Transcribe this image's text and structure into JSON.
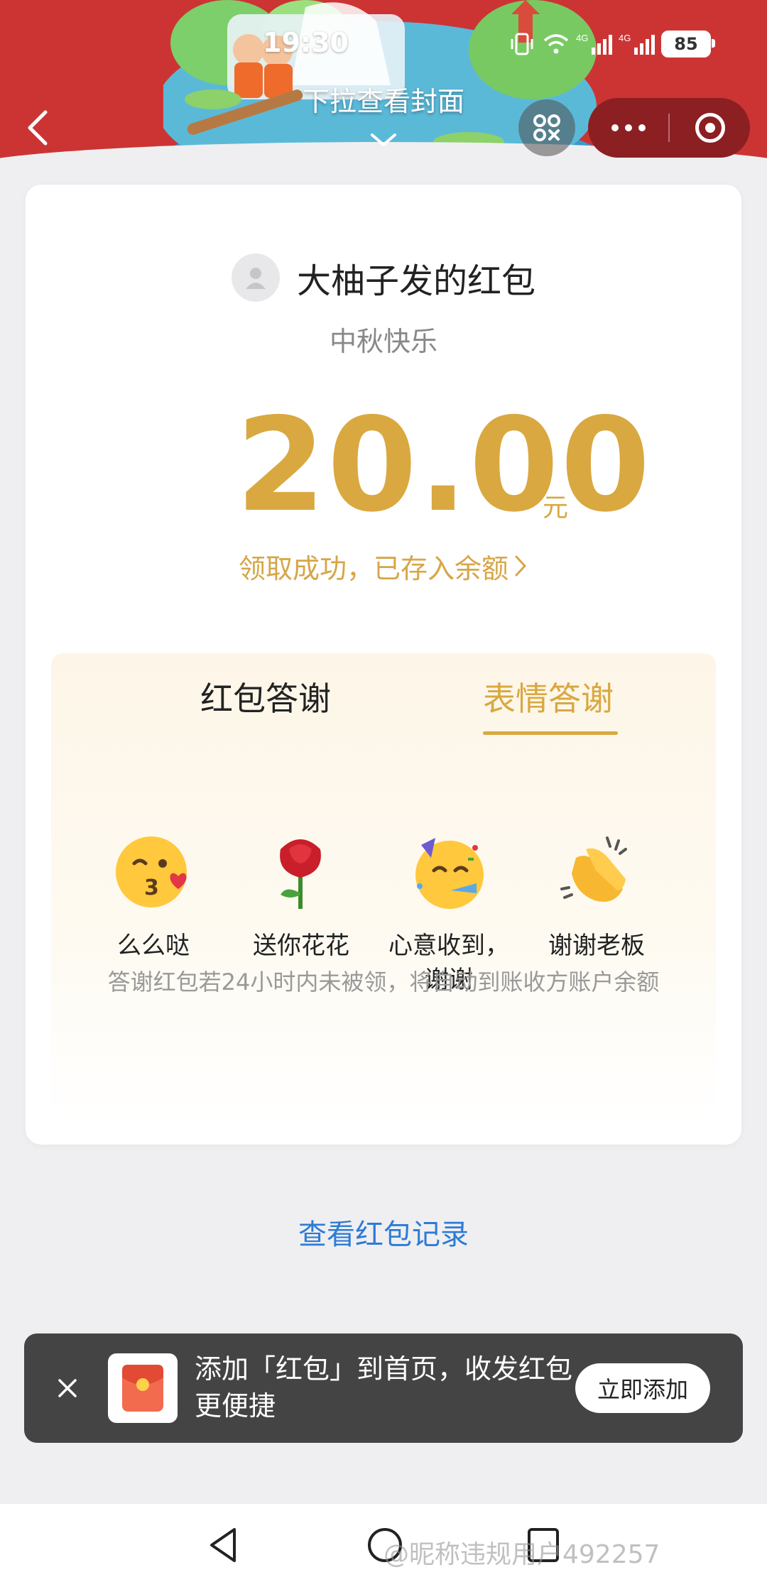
{
  "status_bar": {
    "time": "19:30",
    "battery": "85"
  },
  "header": {
    "pull_hint": "下拉查看封面"
  },
  "card": {
    "sender_title": "大柚子发的红包",
    "blessing": "中秋快乐",
    "amount": "20.00",
    "unit": "元",
    "received_status": "领取成功，已存入余额",
    "tabs": [
      {
        "label": "红包答谢"
      },
      {
        "label": "表情答谢"
      }
    ],
    "emojis": [
      {
        "label": "么么哒",
        "icon": "kissing-face-icon"
      },
      {
        "label": "送你花花",
        "icon": "rose-icon"
      },
      {
        "label": "心意收到，谢谢",
        "icon": "party-face-icon"
      },
      {
        "label": "谢谢老板",
        "icon": "clapping-hands-icon"
      }
    ],
    "notice": "答谢红包若24小时内未被领，将自动到账收方账户余额"
  },
  "record_link": "查看红包记录",
  "toast": {
    "text": "添加「红包」到首页，收发红包更便捷",
    "button": "立即添加"
  },
  "watermark": "@昵称违规用户492257",
  "colors": {
    "brand_red": "#cc3434",
    "gold": "#d9a840",
    "link_blue": "#2e7bd6"
  }
}
